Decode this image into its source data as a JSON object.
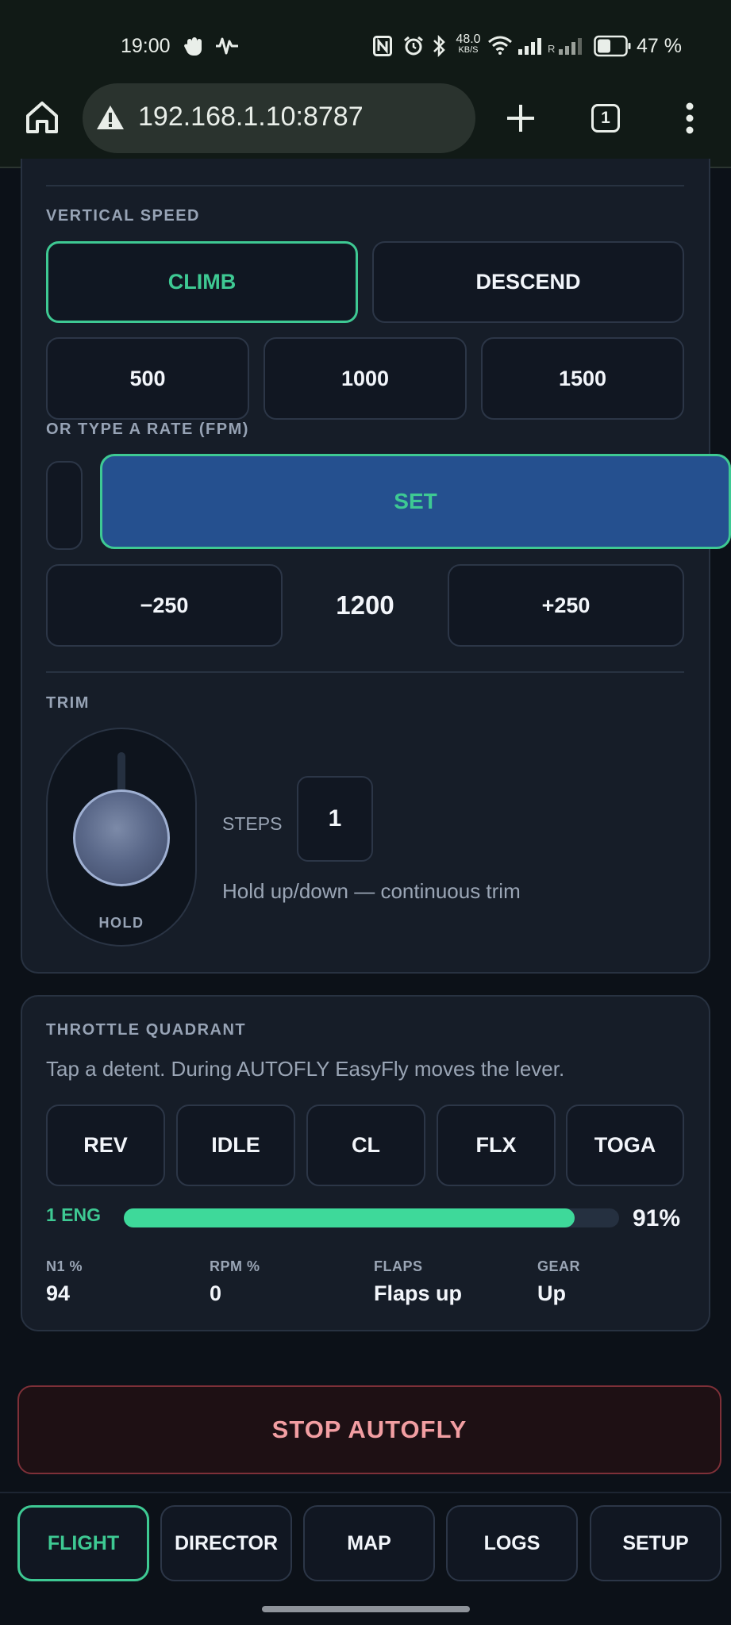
{
  "status_bar": {
    "time": "19:00",
    "net_speed_value": "48.0",
    "net_speed_unit": "KB/S",
    "roaming_label": "R",
    "battery_percent": "47 %",
    "battery_level": 0.47
  },
  "browser": {
    "url": "192.168.1.10:8787",
    "tab_count": "1"
  },
  "vertical_speed": {
    "label": "VERTICAL SPEED",
    "climb": "CLIMB",
    "descend": "DESCEND",
    "selected": "CLIMB",
    "presets": [
      "500",
      "1000",
      "1500"
    ],
    "rate_label": "OR TYPE A RATE (FPM)",
    "rate_value": "",
    "set": "SET",
    "minus": "−250",
    "current": "1200",
    "plus": "+250"
  },
  "trim": {
    "label": "TRIM",
    "hold": "HOLD",
    "steps_label": "STEPS",
    "steps_value": "1",
    "hint": "Hold up/down — continuous trim"
  },
  "throttle": {
    "label": "THROTTLE QUADRANT",
    "hint": "Tap a detent. During AUTOFLY EasyFly moves the lever.",
    "detents": [
      "REV",
      "IDLE",
      "CL",
      "FLX",
      "TOGA"
    ],
    "engine_label": "1 ENG",
    "percent": "91%",
    "level": 0.91,
    "stats": [
      {
        "label": "N1 %",
        "value": "94"
      },
      {
        "label": "RPM %",
        "value": "0"
      },
      {
        "label": "FLAPS",
        "value": "Flaps up"
      },
      {
        "label": "GEAR",
        "value": "Up"
      }
    ]
  },
  "stop_autofly": "STOP AUTOFLY",
  "nav": {
    "items": [
      "FLIGHT",
      "DIRECTOR",
      "MAP",
      "LOGS",
      "SETUP"
    ],
    "active": "FLIGHT"
  },
  "colors": {
    "accent": "#3ec993",
    "panel": "#161d28",
    "set_button": "#25508f",
    "stop_text": "#f29ea2"
  }
}
